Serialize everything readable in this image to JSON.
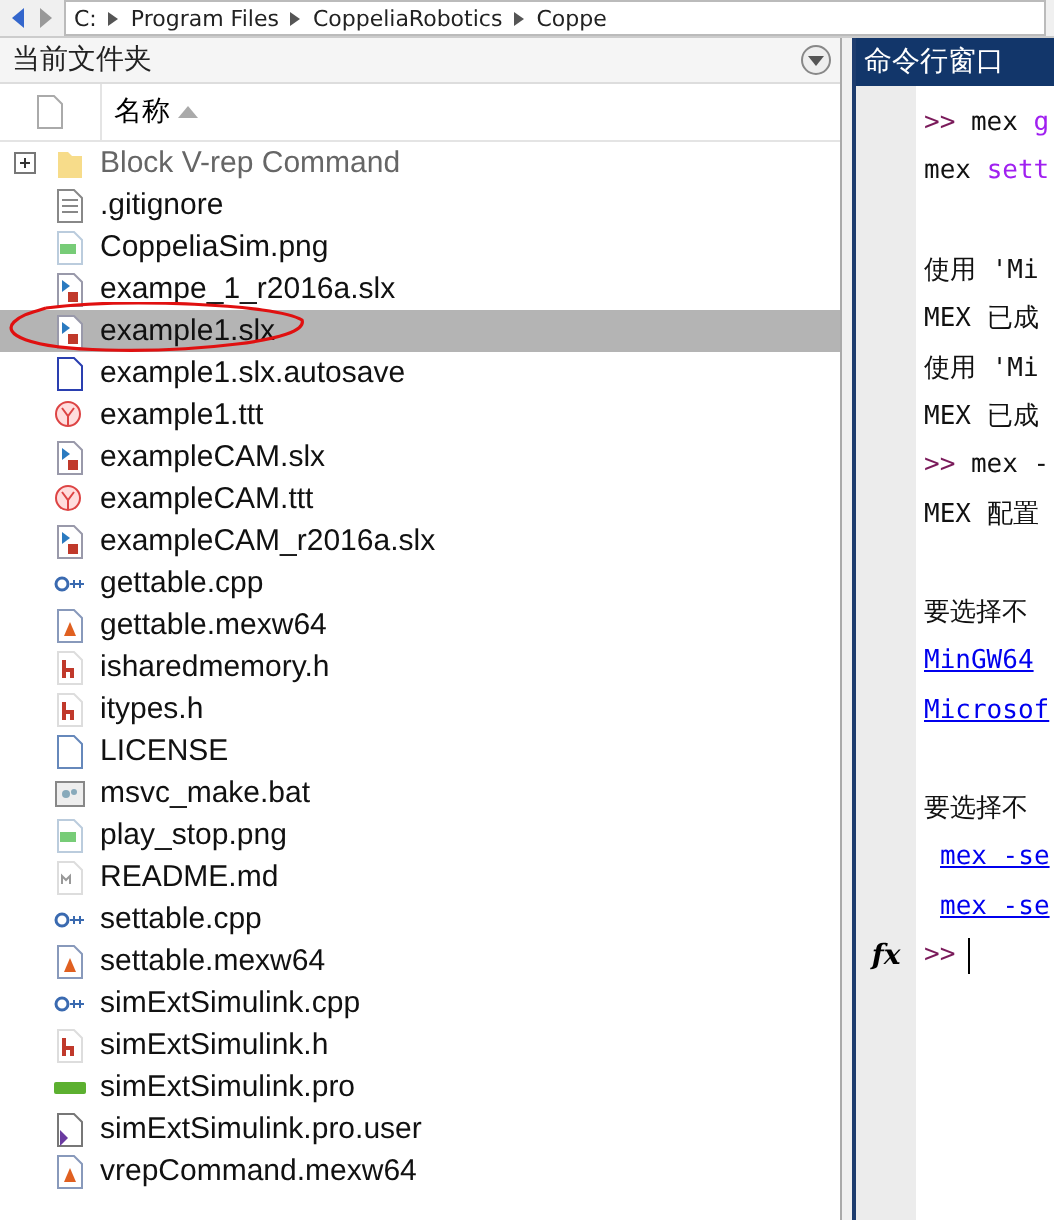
{
  "address_bar": {
    "crumbs": [
      "C:",
      "Program Files",
      "CoppeliaRobotics",
      "Coppe"
    ]
  },
  "current_folder": {
    "title": "当前文件夹",
    "column": "名称",
    "sort_ascending": true,
    "files": [
      {
        "name": "Block V-rep Command",
        "kind": "folder",
        "selected": false,
        "expandable": true
      },
      {
        "name": ".gitignore",
        "kind": "text",
        "selected": false
      },
      {
        "name": "CoppeliaSim.png",
        "kind": "image",
        "selected": false
      },
      {
        "name": "exampe_1_r2016a.slx",
        "kind": "model",
        "selected": false
      },
      {
        "name": "example1.slx",
        "kind": "model",
        "selected": true,
        "circled": true
      },
      {
        "name": "example1.slx.autosave",
        "kind": "autosave",
        "selected": false
      },
      {
        "name": "example1.ttt",
        "kind": "scene",
        "selected": false
      },
      {
        "name": "exampleCAM.slx",
        "kind": "model",
        "selected": false
      },
      {
        "name": "exampleCAM.ttt",
        "kind": "scene",
        "selected": false
      },
      {
        "name": "exampleCAM_r2016a.slx",
        "kind": "model",
        "selected": false
      },
      {
        "name": "gettable.cpp",
        "kind": "cpp",
        "selected": false
      },
      {
        "name": "gettable.mexw64",
        "kind": "mex",
        "selected": false
      },
      {
        "name": "isharedmemory.h",
        "kind": "header",
        "selected": false
      },
      {
        "name": "itypes.h",
        "kind": "header",
        "selected": false
      },
      {
        "name": "LICENSE",
        "kind": "blank",
        "selected": false
      },
      {
        "name": "msvc_make.bat",
        "kind": "batch",
        "selected": false
      },
      {
        "name": "play_stop.png",
        "kind": "image",
        "selected": false
      },
      {
        "name": "README.md",
        "kind": "markdown",
        "selected": false
      },
      {
        "name": "settable.cpp",
        "kind": "cpp",
        "selected": false
      },
      {
        "name": "settable.mexw64",
        "kind": "mex",
        "selected": false
      },
      {
        "name": "simExtSimulink.cpp",
        "kind": "cpp",
        "selected": false
      },
      {
        "name": "simExtSimulink.h",
        "kind": "header",
        "selected": false
      },
      {
        "name": "simExtSimulink.pro",
        "kind": "project",
        "selected": false
      },
      {
        "name": "simExtSimulink.pro.user",
        "kind": "user",
        "selected": false
      },
      {
        "name": "vrepCommand.mexw64",
        "kind": "mex",
        "selected": false
      }
    ]
  },
  "command_window": {
    "title": "命令行窗口",
    "lines": [
      {
        "kind": "text",
        "segments": [
          {
            "text": ">>",
            "kind": "prompt"
          },
          {
            "text": " mex ",
            "kind": "plain"
          },
          {
            "text": "g",
            "kind": "string"
          }
        ]
      },
      {
        "kind": "text",
        "segments": [
          {
            "text": "mex ",
            "kind": "plain"
          },
          {
            "text": "sett",
            "kind": "string"
          }
        ]
      },
      {
        "kind": "blank"
      },
      {
        "kind": "text",
        "segments": [
          {
            "text": "使用 'Mi",
            "kind": "plain"
          }
        ]
      },
      {
        "kind": "text",
        "segments": [
          {
            "text": "MEX 已成",
            "kind": "plain"
          }
        ]
      },
      {
        "kind": "text",
        "segments": [
          {
            "text": "使用 'Mi",
            "kind": "plain"
          }
        ]
      },
      {
        "kind": "text",
        "segments": [
          {
            "text": "MEX 已成",
            "kind": "plain"
          }
        ]
      },
      {
        "kind": "text",
        "segments": [
          {
            "text": ">>",
            "kind": "prompt"
          },
          {
            "text": " mex -",
            "kind": "plain"
          }
        ]
      },
      {
        "kind": "text",
        "segments": [
          {
            "text": "MEX 配置",
            "kind": "plain"
          }
        ]
      },
      {
        "kind": "blank"
      },
      {
        "kind": "text",
        "segments": [
          {
            "text": "要选择不",
            "kind": "plain"
          }
        ]
      },
      {
        "kind": "text",
        "segments": [
          {
            "text": "MinGW64",
            "kind": "link"
          }
        ]
      },
      {
        "kind": "text",
        "segments": [
          {
            "text": "Microsof",
            "kind": "link"
          }
        ]
      },
      {
        "kind": "blank"
      },
      {
        "kind": "text",
        "segments": [
          {
            "text": "要选择不",
            "kind": "plain"
          }
        ]
      },
      {
        "kind": "indented",
        "segments": [
          {
            "text": "mex -se",
            "kind": "link"
          }
        ]
      },
      {
        "kind": "indented",
        "segments": [
          {
            "text": "mex -se",
            "kind": "link"
          }
        ]
      }
    ],
    "input": {
      "fx": "fx",
      "prompt": ">>"
    }
  }
}
